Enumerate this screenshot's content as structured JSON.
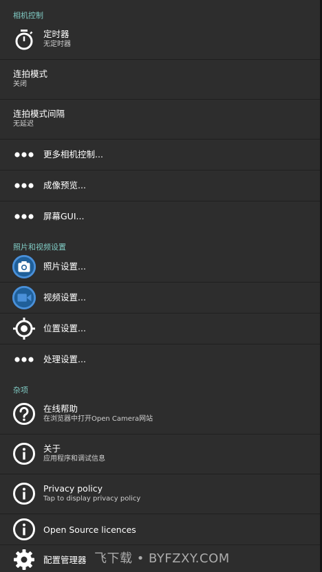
{
  "sections": {
    "camera_controls": "相机控制",
    "photo_video": "照片和视频设置",
    "misc": "杂项"
  },
  "items": {
    "timer": {
      "title": "定时器",
      "subtitle": "无定时器",
      "icon": "timer-icon"
    },
    "burst_mode": {
      "title": "连拍模式",
      "subtitle": "关闭"
    },
    "burst_interval": {
      "title": "连拍模式间隔",
      "subtitle": "无延迟"
    },
    "more_camera": {
      "title": "更多相机控制...",
      "icon": "more-dots-icon"
    },
    "preview": {
      "title": "成像预览...",
      "icon": "more-dots-icon"
    },
    "screen_gui": {
      "title": "屏幕GUI...",
      "icon": "more-dots-icon"
    },
    "photo_settings": {
      "title": "照片设置...",
      "icon": "camera-icon"
    },
    "video_settings": {
      "title": "视频设置...",
      "icon": "videocam-icon"
    },
    "location_settings": {
      "title": "位置设置...",
      "icon": "location-target-icon"
    },
    "processing_settings": {
      "title": "处理设置...",
      "icon": "more-dots-icon"
    },
    "online_help": {
      "title": "在线帮助",
      "subtitle": "在浏览器中打开Open Camera网站",
      "icon": "help-icon"
    },
    "about": {
      "title": "关于",
      "subtitle": "应用程序和调试信息",
      "icon": "info-icon"
    },
    "privacy": {
      "title": "Privacy policy",
      "subtitle": "Tap to display privacy policy",
      "icon": "info-icon"
    },
    "licences": {
      "title": "Open Source licences",
      "icon": "info-icon"
    },
    "config_manager": {
      "title": "配置管理器",
      "icon": "gear-icon"
    }
  },
  "colors": {
    "accent_blue": "#4a90d9",
    "section_teal": "#80cbc4",
    "background": "#2d2d2d"
  },
  "watermark": "飞下载 • BYFZXY.COM"
}
